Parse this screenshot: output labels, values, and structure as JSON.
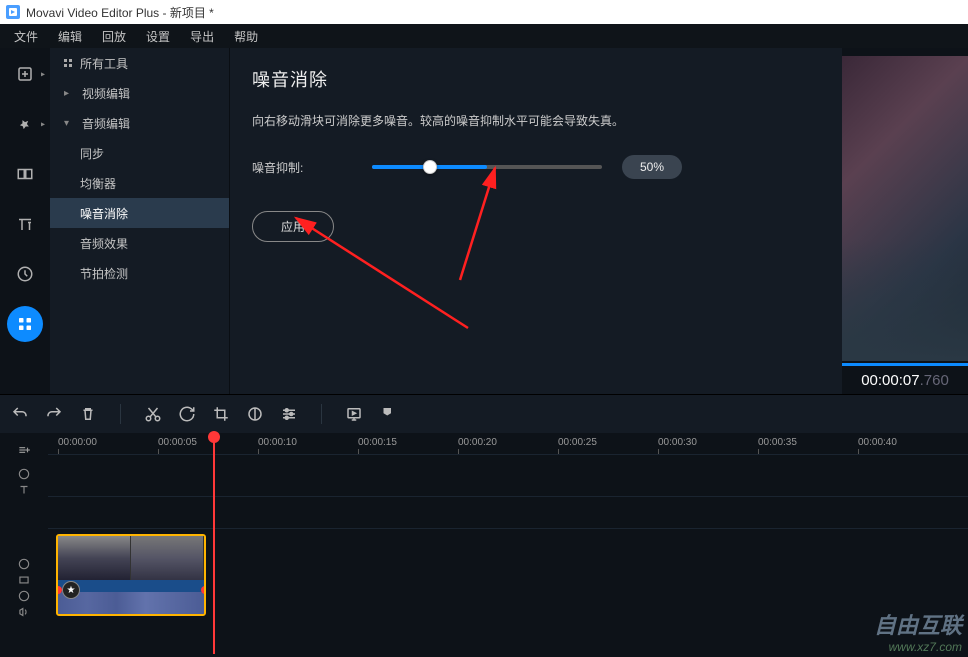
{
  "app": {
    "title": "Movavi Video Editor Plus - 新项目 *"
  },
  "menubar": [
    "文件",
    "编辑",
    "回放",
    "设置",
    "导出",
    "帮助"
  ],
  "toolPanel": {
    "allTools": "所有工具",
    "videoEdit": "视频编辑",
    "audioEdit": "音频编辑",
    "sync": "同步",
    "equalizer": "均衡器",
    "noiseRemoval": "噪音消除",
    "audioEffects": "音频效果",
    "beatDetect": "节拍检测"
  },
  "settings": {
    "title": "噪音消除",
    "description": "向右移动滑块可消除更多噪音。较高的噪音抑制水平可能会导致失真。",
    "sliderLabel": "噪音抑制:",
    "sliderValue": "50%",
    "applyLabel": "应用"
  },
  "preview": {
    "timeMain": "00:00:07",
    "timeMs": ".760"
  },
  "timeline": {
    "ticks": [
      "00:00:00",
      "00:00:05",
      "00:00:10",
      "00:00:15",
      "00:00:20",
      "00:00:25",
      "00:00:30",
      "00:00:35",
      "00:00:40"
    ]
  },
  "watermark": {
    "main": "自由互联",
    "sub": "www.xz7.com"
  }
}
